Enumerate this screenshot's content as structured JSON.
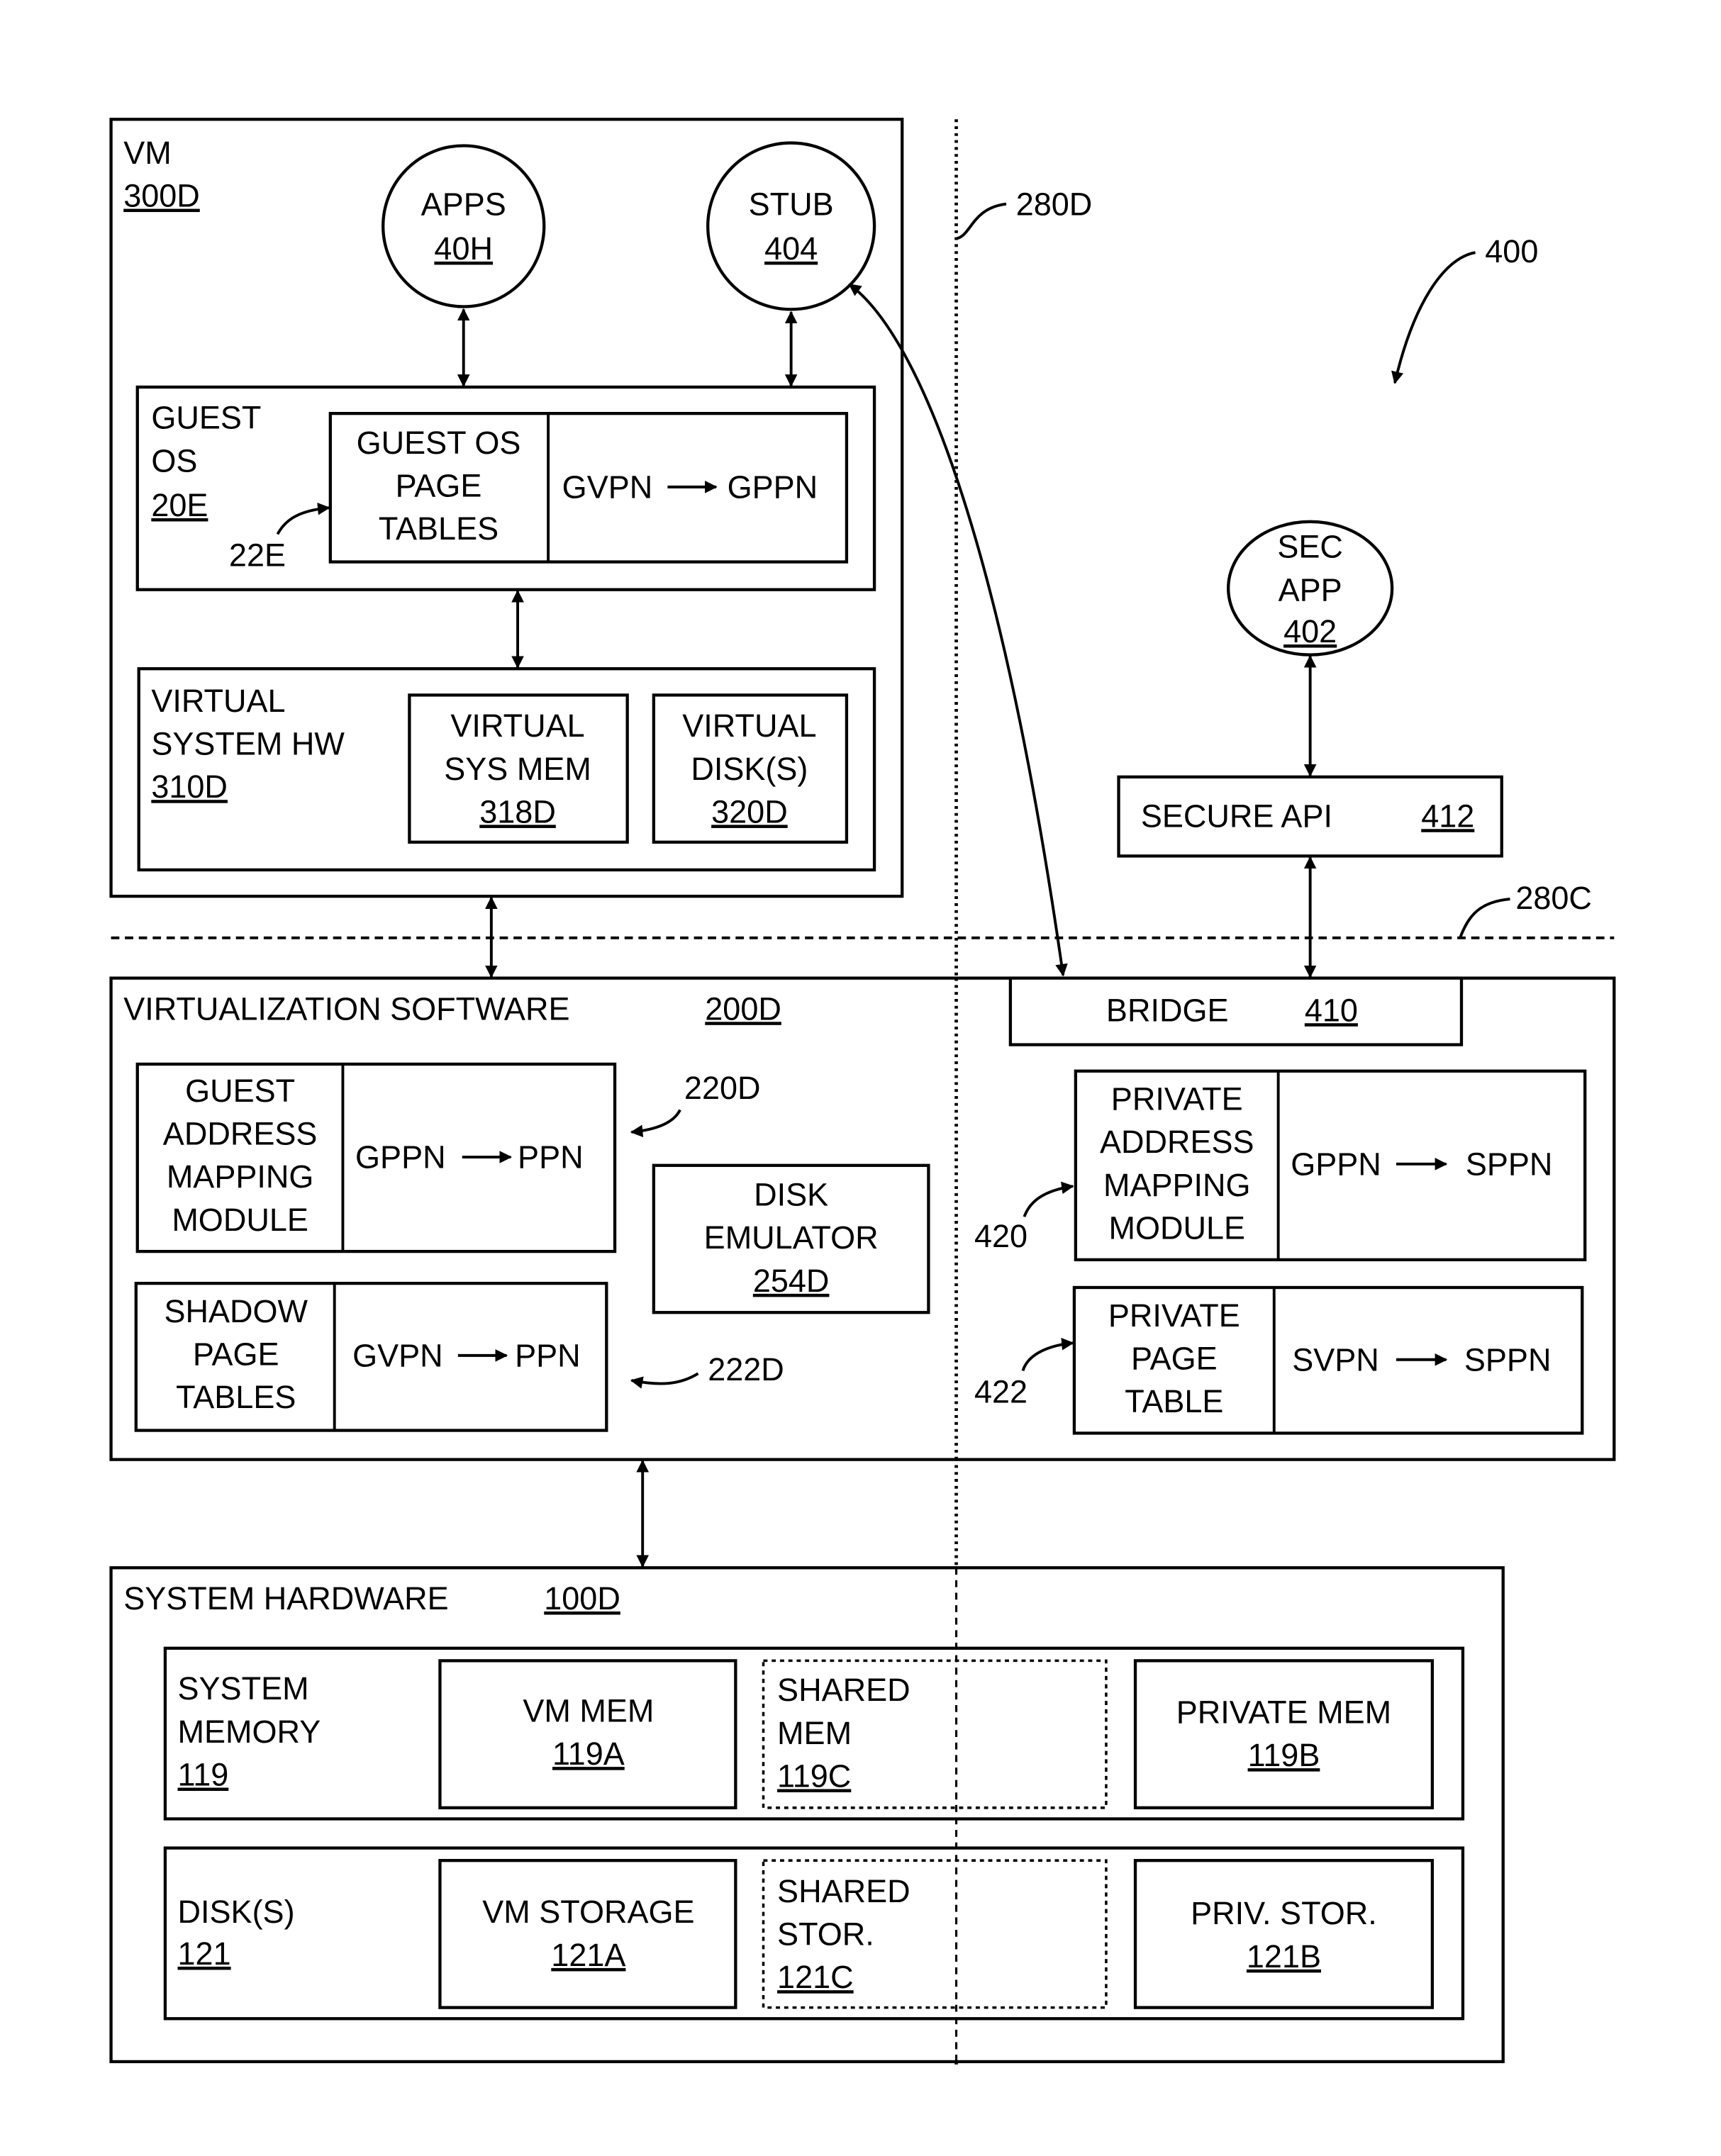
{
  "figure": {
    "ref": "400",
    "separators": {
      "vertical_ref": "280D",
      "horizontal_ref": "280C"
    },
    "vm": {
      "title": "VM",
      "ref": "300D",
      "apps": {
        "label": "APPS",
        "ref": "40H"
      },
      "stub": {
        "label": "STUB",
        "ref": "404"
      },
      "guest_os": {
        "title_lines": [
          "GUEST",
          "OS"
        ],
        "ref": "20E",
        "page_tables": {
          "pointer_ref": "22E",
          "label_lines": [
            "GUEST OS",
            "PAGE",
            "TABLES"
          ],
          "mapping_from": "GVPN",
          "mapping_to": "GPPN"
        }
      },
      "virtual_hw": {
        "title_lines": [
          "VIRTUAL",
          "SYSTEM HW"
        ],
        "ref": "310D",
        "sys_mem": {
          "label_lines": [
            "VIRTUAL",
            "SYS MEM"
          ],
          "ref": "318D"
        },
        "disks": {
          "label_lines": [
            "VIRTUAL",
            "DISK(S)"
          ],
          "ref": "320D"
        }
      }
    },
    "secure_side": {
      "sec_app": {
        "label_lines": [
          "SEC",
          "APP"
        ],
        "ref": "402"
      },
      "secure_api": {
        "label": "SECURE API",
        "ref": "412"
      }
    },
    "virtualization": {
      "title": "VIRTUALIZATION SOFTWARE",
      "ref": "200D",
      "guest_address_mapping": {
        "pointer_ref": "220D",
        "label_lines": [
          "GUEST",
          "ADDRESS",
          "MAPPING",
          "MODULE"
        ],
        "mapping_from": "GPPN",
        "mapping_to": "PPN"
      },
      "shadow_page_tables": {
        "pointer_ref": "222D",
        "label_lines": [
          "SHADOW",
          "PAGE",
          "TABLES"
        ],
        "mapping_from": "GVPN",
        "mapping_to": "PPN"
      },
      "disk_emulator": {
        "label_lines": [
          "DISK",
          "EMULATOR"
        ],
        "ref": "254D"
      },
      "bridge": {
        "label": "BRIDGE",
        "ref": "410"
      },
      "private_address_mapping": {
        "pointer_ref": "420",
        "label_lines": [
          "PRIVATE",
          "ADDRESS",
          "MAPPING",
          "MODULE"
        ],
        "mapping_from": "GPPN",
        "mapping_to": "SPPN"
      },
      "private_page_table": {
        "pointer_ref": "422",
        "label_lines": [
          "PRIVATE",
          "PAGE",
          "TABLE"
        ],
        "mapping_from": "SVPN",
        "mapping_to": "SPPN"
      }
    },
    "system_hardware": {
      "title": "SYSTEM HARDWARE",
      "ref": "100D",
      "memory": {
        "title_lines": [
          "SYSTEM",
          "MEMORY"
        ],
        "ref": "119",
        "vm": {
          "label": "VM MEM",
          "ref": "119A"
        },
        "shared": {
          "label_lines": [
            "SHARED",
            "MEM"
          ],
          "ref": "119C"
        },
        "private": {
          "label": "PRIVATE MEM",
          "ref": "119B"
        }
      },
      "disks": {
        "title_lines": [
          "DISK(S)"
        ],
        "ref": "121",
        "vm": {
          "label": "VM STORAGE",
          "ref": "121A"
        },
        "shared": {
          "label_lines": [
            "SHARED",
            "STOR."
          ],
          "ref": "121C"
        },
        "private": {
          "label": "PRIV. STOR.",
          "ref": "121B"
        }
      }
    }
  }
}
